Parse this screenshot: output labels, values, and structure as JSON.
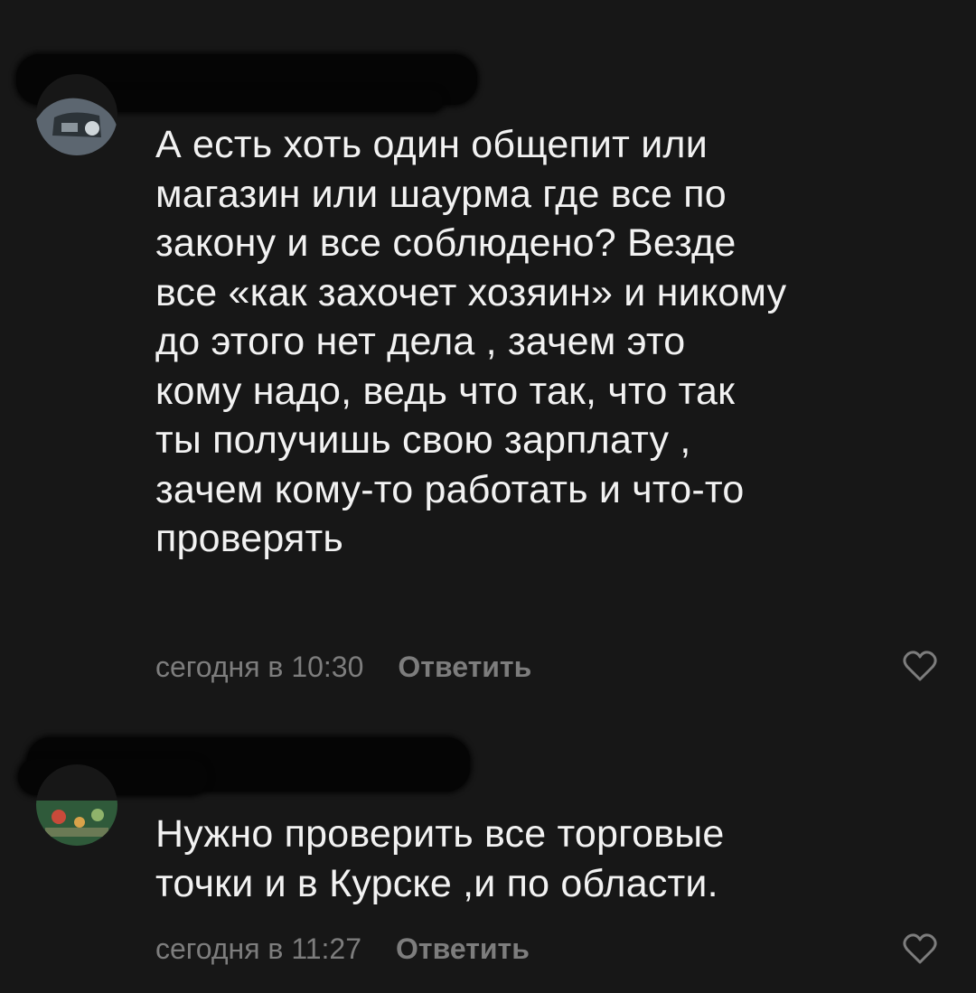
{
  "comments": [
    {
      "text": "А есть хоть один общепит или\nмагазин или шаурма где все по\nзакону и все соблюдено? Везде\nвсе «как захочет хозяин» и никому\nдо этого нет дела , зачем это\nкому надо, ведь что так, что так\nты получишь свою зарплату ,\nзачем кому-то работать и что-то\nпроверять",
      "time": "сегодня в 10:30",
      "reply_label": "Ответить",
      "like_icon": "heart-outline-icon"
    },
    {
      "text": "Нужно проверить все торговые\nточки и в Курске ,и по области.",
      "time": "сегодня в 11:27",
      "reply_label": "Ответить",
      "like_icon": "heart-outline-icon"
    }
  ],
  "colors": {
    "background": "#171717",
    "text": "#f2f2f2",
    "meta": "#7d7d7d",
    "redaction": "#050505"
  }
}
